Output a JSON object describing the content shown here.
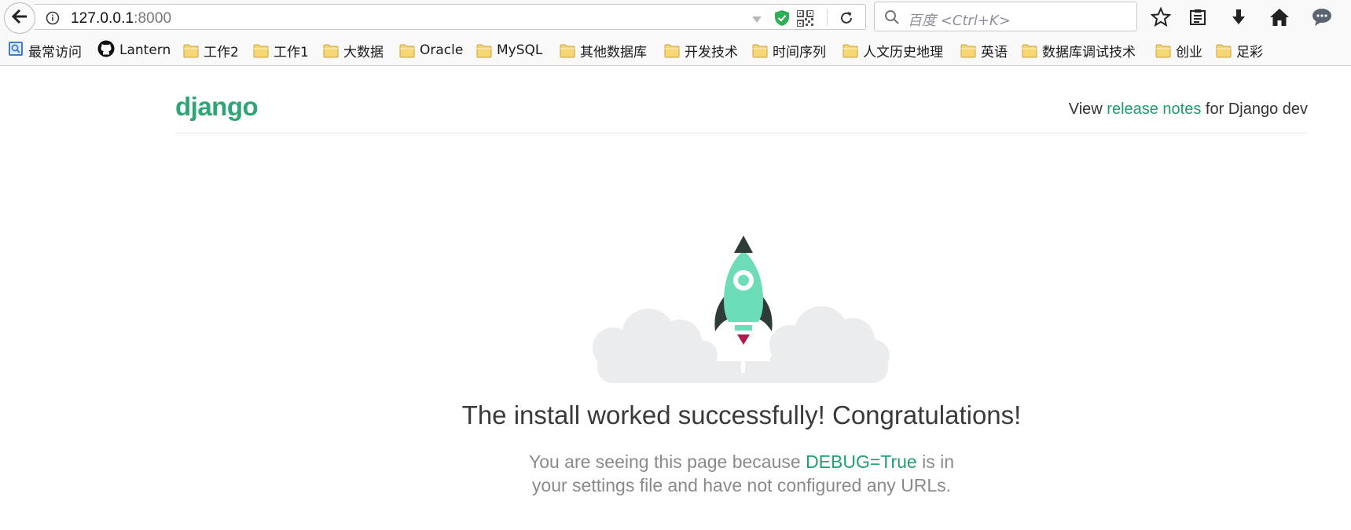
{
  "browser": {
    "url_host": "127.0.0.1",
    "url_port": ":8000",
    "search_placeholder": "百度 <Ctrl+K>"
  },
  "bookmarks": [
    {
      "label": "最常访问",
      "icon": "most-visited-icon"
    },
    {
      "label": "Lantern",
      "icon": "github-icon"
    },
    {
      "label": "工作2",
      "icon": "folder-icon"
    },
    {
      "label": "工作1",
      "icon": "folder-icon"
    },
    {
      "label": "大数据",
      "icon": "folder-icon"
    },
    {
      "label": "Oracle",
      "icon": "folder-icon"
    },
    {
      "label": "MySQL",
      "icon": "folder-icon"
    },
    {
      "label": "其他数据库",
      "icon": "folder-icon"
    },
    {
      "label": "开发技术",
      "icon": "folder-icon"
    },
    {
      "label": "时间序列",
      "icon": "folder-icon"
    },
    {
      "label": "人文历史地理",
      "icon": "folder-icon"
    },
    {
      "label": "英语",
      "icon": "folder-icon"
    },
    {
      "label": "数据库调试技术",
      "icon": "folder-icon"
    },
    {
      "label": "创业",
      "icon": "folder-icon"
    },
    {
      "label": "足彩",
      "icon": "folder-icon"
    }
  ],
  "header": {
    "logo": "django",
    "release_prefix": "View ",
    "release_link": "release notes",
    "release_suffix": " for Django dev"
  },
  "main": {
    "title": "The install worked successfully! Congratulations!",
    "sub_line1_prefix": "You are seeing this page because ",
    "sub_debug": "DEBUG=True",
    "sub_line1_suffix": " is in",
    "sub_line2": "your settings file and have not configured any URLs."
  },
  "colors": {
    "brand": "#2ea574",
    "link": "#1f9c6a",
    "rocket_body": "#6dddb9",
    "rocket_dark": "#2f3b39",
    "flame": "#b01b4b",
    "cloud": "#ebecee"
  }
}
